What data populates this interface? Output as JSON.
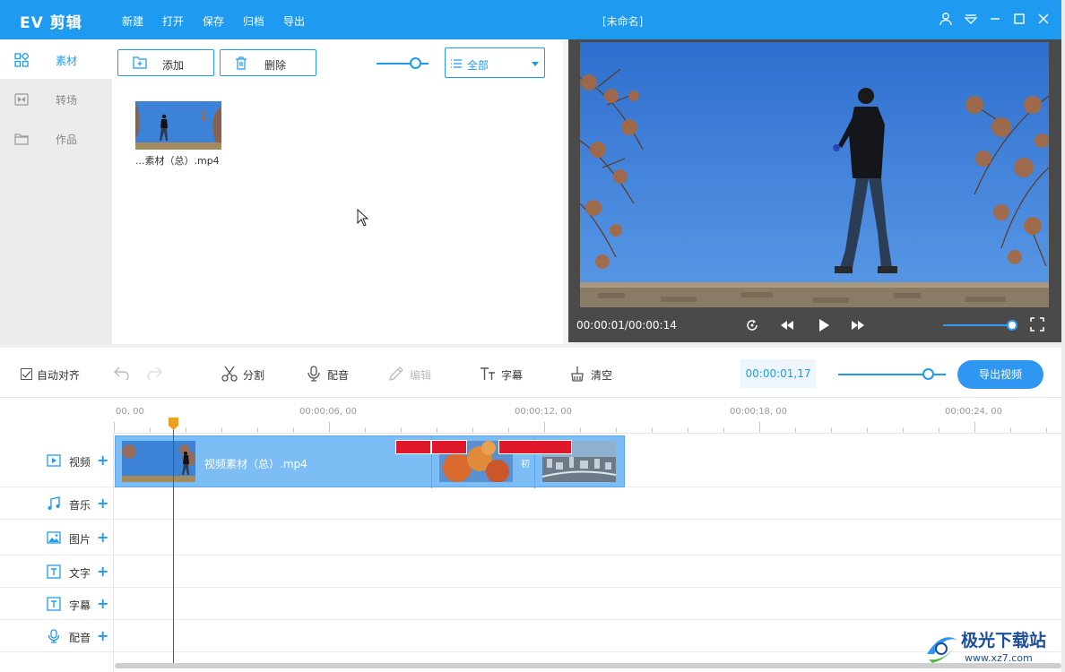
{
  "app": {
    "logo": "EV 剪辑",
    "menu": [
      "新建",
      "打开",
      "保存",
      "归档",
      "导出"
    ],
    "doc_title": "[未命名]"
  },
  "sidebar": {
    "items": [
      {
        "label": "素材",
        "icon": "grid-icon",
        "active": true
      },
      {
        "label": "转场",
        "icon": "transition-icon",
        "active": false
      },
      {
        "label": "作品",
        "icon": "folder-icon",
        "active": false
      }
    ]
  },
  "media": {
    "add_label": "添加",
    "delete_label": "删除",
    "filter_value": "全部",
    "items": [
      {
        "name": "...素材（总）.mp4"
      }
    ]
  },
  "preview": {
    "timecode": "00:00:01/00:00:14",
    "volume_level": 0.9
  },
  "toolbar": {
    "auto_align_label": "自动对齐",
    "auto_align_checked": true,
    "split_label": "分割",
    "dub_label": "配音",
    "edit_label": "编辑",
    "subtitle_label": "字幕",
    "clear_label": "清空",
    "current_time": "00:00:01,17",
    "export_label": "导出视频"
  },
  "timeline": {
    "ruler_labels": [
      "00, 00",
      "00:00:06, 00",
      "00:00:12, 00",
      "00:00:18, 00",
      "00:00:24, 00"
    ],
    "tracks": [
      {
        "label": "视频",
        "icon": "video-icon"
      },
      {
        "label": "音乐",
        "icon": "music-icon"
      },
      {
        "label": "图片",
        "icon": "image-icon"
      },
      {
        "label": "文字",
        "icon": "text-icon"
      },
      {
        "label": "字幕",
        "icon": "subtitle-icon"
      },
      {
        "label": "配音",
        "icon": "mic-icon"
      }
    ],
    "clip_name": "视频素材（总）.mp4",
    "clip_mid_char": "初"
  },
  "watermark": {
    "brand": "极光下载站",
    "url": "www.xz7.com"
  },
  "colors": {
    "accent": "#1e9bf0",
    "marker_red": "#e0182b",
    "clip_blue": "#7cbdf5"
  }
}
